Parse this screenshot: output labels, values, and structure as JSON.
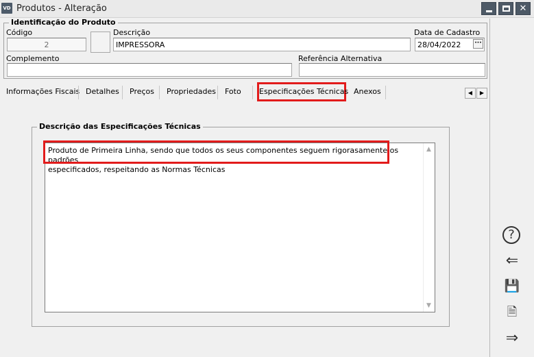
{
  "window": {
    "app_icon_label": "VD",
    "title": "Produtos - Alteração",
    "minimize_glyph": "",
    "maximize_glyph": "",
    "close_glyph": "✕"
  },
  "identification": {
    "group_title": "Identificação do Produto",
    "codigo_label": "Código",
    "codigo_value": "2",
    "descricao_label": "Descrição",
    "descricao_value": "IMPRESSORA",
    "data_cadastro_label": "Data de Cadastro",
    "data_cadastro_value": "28/04/2022",
    "date_picker_glyph": "···",
    "complemento_label": "Complemento",
    "complemento_value": "",
    "referencia_label": "Referência Alternativa",
    "referencia_value": ""
  },
  "tabs": {
    "items": [
      {
        "label": "Informações Fiscais"
      },
      {
        "label": "Detalhes"
      },
      {
        "label": "Preços"
      },
      {
        "label": "Propriedades"
      },
      {
        "label": "Foto"
      },
      {
        "label": "Especificações Técnicas",
        "active": true
      },
      {
        "label": "Anexos"
      }
    ],
    "scroll_left_glyph": "◀",
    "scroll_right_glyph": "▶"
  },
  "specs": {
    "group_title": "Descrição das Especificações Técnicas",
    "text": "Produto de Primeira Linha,  sendo que todos os seus componentes seguem rigorasamente os padrões\nespecificados, respeitando as Normas Técnicas",
    "scroll_up_glyph": "▲",
    "scroll_down_glyph": "▼"
  },
  "side_actions": [
    {
      "icon": "help-icon",
      "glyph": "?"
    },
    {
      "icon": "back-arrow-icon",
      "glyph": "⇐"
    },
    {
      "icon": "save-icon",
      "glyph": "💾"
    },
    {
      "icon": "delete-document-icon",
      "glyph": "🗎"
    },
    {
      "icon": "forward-arrow-icon",
      "glyph": "⇒"
    }
  ],
  "colors": {
    "highlight": "#e21b1b",
    "window_button": "#4d5966"
  }
}
